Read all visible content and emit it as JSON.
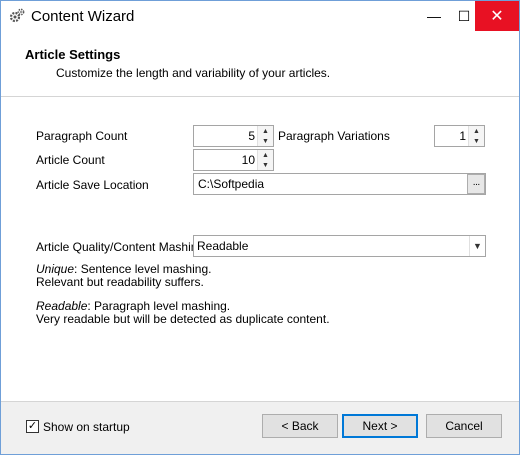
{
  "window": {
    "title": "Content Wizard",
    "controls": {
      "minimize": "—",
      "maximize": "☐",
      "close": "✕"
    }
  },
  "header": {
    "title": "Article Settings",
    "subtitle": "Customize the length and variability of your articles."
  },
  "form": {
    "paragraph_count": {
      "label": "Paragraph Count",
      "value": "5"
    },
    "paragraph_variations": {
      "label": "Paragraph Variations",
      "value": "1"
    },
    "article_count": {
      "label": "Article Count",
      "value": "10"
    },
    "save_location": {
      "label": "Article Save Location",
      "value": "C:\\Softpedia",
      "browse_label": "···"
    },
    "quality": {
      "label": "Article Quality/Content Mashing",
      "value": "Readable"
    }
  },
  "descriptions": {
    "unique_term": "Unique",
    "unique_text": ": Sentence level mashing.",
    "unique_line2": "Relevant but readability suffers.",
    "readable_term": "Readable",
    "readable_text": ": Paragraph level mashing.",
    "readable_line2": "Very readable but will be detected as duplicate content."
  },
  "footer": {
    "show_on_startup_label": "Show on startup",
    "show_on_startup_checked": true,
    "back_label": "< Back",
    "next_label": "Next >",
    "cancel_label": "Cancel"
  },
  "icons": {
    "app": "gear-icon",
    "spin_up": "▲",
    "spin_down": "▼",
    "dropdown": "▼",
    "check": "✓"
  },
  "colors": {
    "close_button": "#e81123",
    "window_border": "#6f9fd8",
    "default_button_border": "#0078d7"
  }
}
